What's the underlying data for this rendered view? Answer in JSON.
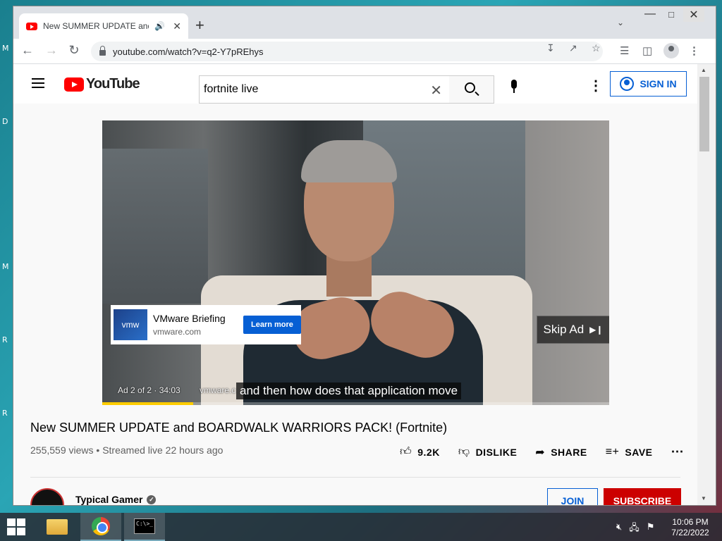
{
  "desktop": {
    "edge_letters": [
      "M",
      "D",
      "M",
      "R",
      "R"
    ]
  },
  "browser": {
    "tab_title": "New SUMMER UPDATE and BOARDWALK WARRIORS PACK! (Fortnite)",
    "tab_audio_icon": "speaker-icon",
    "new_tab_label": "+",
    "url": "youtube.com/watch?v=q2-Y7pREhys"
  },
  "youtube": {
    "logo_text": "YouTube",
    "search_value": "fortnite live",
    "signin_label": "SIGN IN",
    "ad": {
      "logo_text": "vmw",
      "title": "VMware Briefing",
      "domain": "vmware.com",
      "cta": "Learn more",
      "skip_label": "Skip Ad",
      "status": "Ad 2 of 2 · 34:03",
      "overlay_domain": "vmware.c",
      "progress": 0.18
    },
    "caption": "and then how does that application move",
    "video": {
      "title": "New SUMMER UPDATE and BOARDWALK WARRIORS PACK! (Fortnite)",
      "views": "255,559 views",
      "streamed": "Streamed live 22 hours ago",
      "likes": "9.2K",
      "dislike_label": "DISLIKE",
      "share_label": "SHARE",
      "save_label": "SAVE"
    },
    "channel": {
      "name": "Typical Gamer",
      "join_label": "JOIN",
      "subscribe_label": "SUBSCRIBE"
    }
  },
  "taskbar": {
    "time": "10:06 PM",
    "date": "7/22/2022",
    "cmd_text": "C:\\>_"
  },
  "colors": {
    "accent": "#065fd4",
    "youtube_red": "#ff0000",
    "subscribe_red": "#cc0000",
    "ad_progress": "#ffcc00"
  }
}
